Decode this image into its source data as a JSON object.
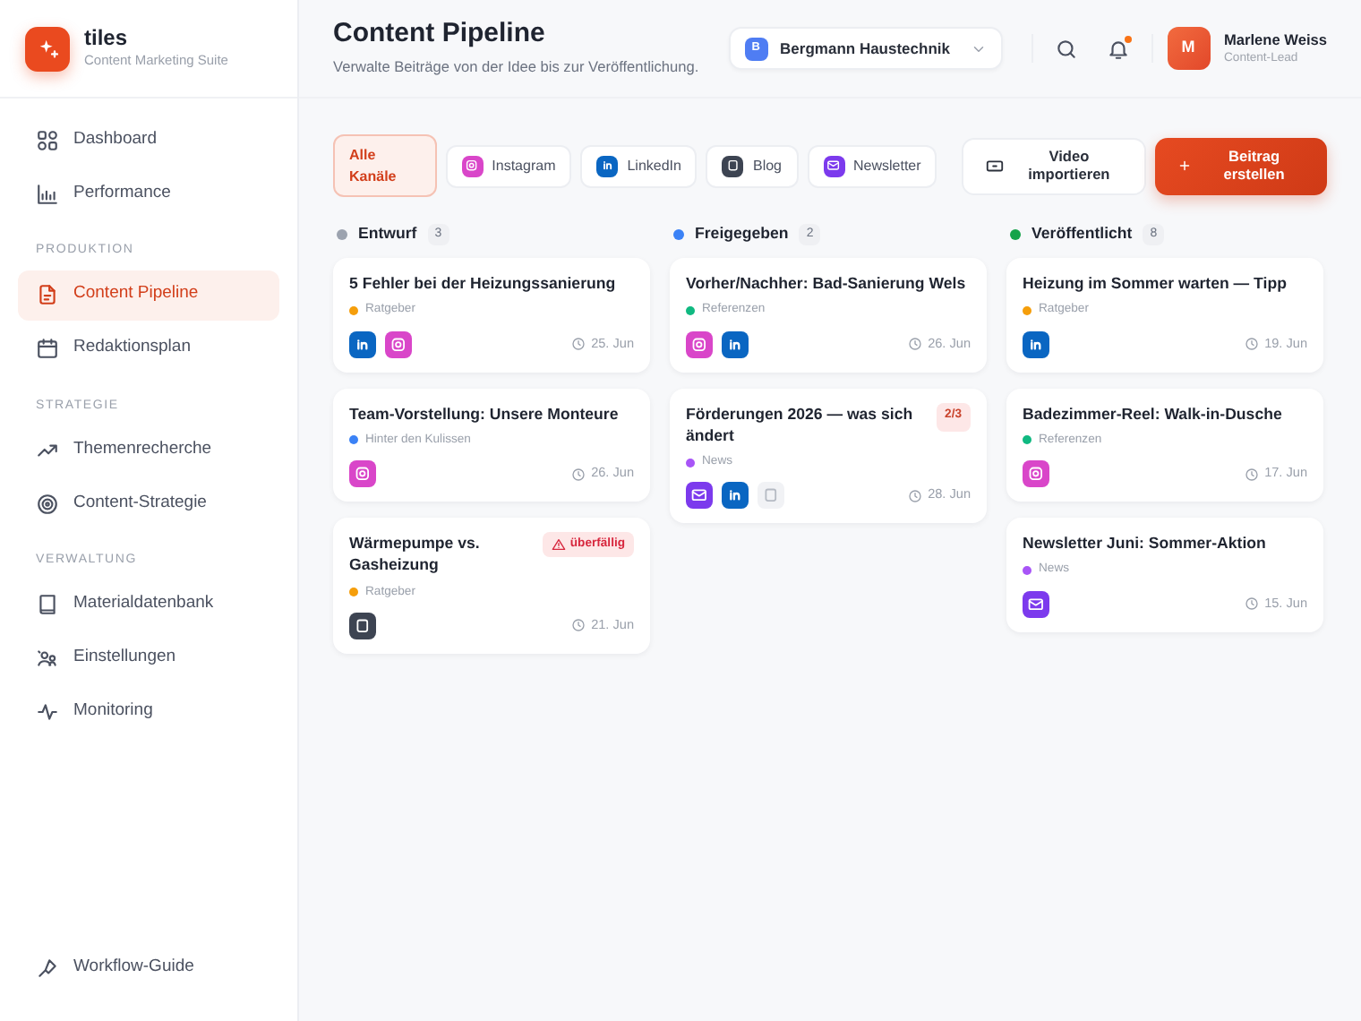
{
  "brand": {
    "name": "tiles",
    "tagline": "Content Marketing Suite"
  },
  "sidebar": {
    "groups": [
      {
        "items": [
          {
            "label": "Dashboard",
            "selected": false
          },
          {
            "label": "Performance",
            "selected": false
          }
        ]
      },
      {
        "heading": "PRODUKTION",
        "items": [
          {
            "label": "Content Pipeline",
            "selected": true
          },
          {
            "label": "Redaktionsplan",
            "selected": false
          }
        ]
      },
      {
        "heading": "STRATEGIE",
        "items": [
          {
            "label": "Themenrecherche",
            "selected": false
          },
          {
            "label": "Content-Strategie",
            "selected": false
          }
        ]
      },
      {
        "heading": "VERWALTUNG",
        "items": [
          {
            "label": "Materialdatenbank",
            "selected": false
          },
          {
            "label": "Einstellungen",
            "selected": false
          },
          {
            "label": "Monitoring",
            "selected": false
          }
        ]
      }
    ],
    "footer_link": "Workflow-Guide"
  },
  "header": {
    "title": "Content Pipeline",
    "subtitle": "Verwalte Beiträge von der Idee bis zur Veröffentlichung.",
    "workspace": {
      "initial": "B",
      "name": "Bergmann Haustechnik"
    },
    "notifications": {
      "unread": true
    },
    "user": {
      "initial": "M",
      "name": "Marlene Weiss",
      "role": "Content-Lead"
    }
  },
  "filters": [
    {
      "label": "Alle Kanäle",
      "kind": "all",
      "selected": true
    },
    {
      "label": "Instagram",
      "kind": "instagram",
      "selected": false
    },
    {
      "label": "LinkedIn",
      "kind": "linkedin",
      "selected": false
    },
    {
      "label": "Blog",
      "kind": "blog",
      "selected": false
    },
    {
      "label": "Newsletter",
      "kind": "newsletter",
      "selected": false
    }
  ],
  "actions": [
    {
      "label": "Video importieren",
      "kind": "secondary"
    },
    {
      "label": "Beitrag erstellen",
      "kind": "primary"
    }
  ],
  "columns": [
    {
      "title": "Entwurf",
      "count": "3",
      "color": "#9ca3af",
      "cards": [
        {
          "title": "5 Fehler bei der Heizungssanierung",
          "tag": {
            "label": "Ratgeber",
            "color": "#f59e0b"
          },
          "channels": [
            {
              "kind": "linkedin",
              "pending": false
            },
            {
              "kind": "instagram",
              "pending": false
            }
          ],
          "date": "25. Jun"
        },
        {
          "title": "Team-Vorstellung: Unsere Monteure",
          "tag": {
            "label": "Hinter den Kulissen",
            "color": "#3b82f6"
          },
          "channels": [
            {
              "kind": "instagram",
              "pending": false
            }
          ],
          "date": "26. Jun"
        },
        {
          "title": "Wärmepumpe vs. Gasheizung",
          "badge": {
            "label": "überfällig",
            "kind": "overdue"
          },
          "tag": {
            "label": "Ratgeber",
            "color": "#f59e0b"
          },
          "channels": [
            {
              "kind": "blog",
              "pending": false
            }
          ],
          "date": "21. Jun"
        }
      ]
    },
    {
      "title": "Freigegeben",
      "count": "2",
      "color": "#3b82f6",
      "cards": [
        {
          "title": "Vorher/Nachher: Bad-Sanierung Wels",
          "tag": {
            "label": "Referenzen",
            "color": "#10b981"
          },
          "channels": [
            {
              "kind": "instagram",
              "pending": false
            },
            {
              "kind": "linkedin",
              "pending": false
            }
          ],
          "date": "26. Jun"
        },
        {
          "title": "Förderungen 2026 — was sich ändert",
          "badge": {
            "label": "2/3",
            "kind": "progress"
          },
          "tag": {
            "label": "News",
            "color": "#a855f7"
          },
          "channels": [
            {
              "kind": "newsletter",
              "pending": false
            },
            {
              "kind": "linkedin",
              "pending": false
            },
            {
              "kind": "blog",
              "pending": true
            }
          ],
          "date": "28. Jun"
        }
      ]
    },
    {
      "title": "Veröffentlicht",
      "count": "8",
      "color": "#16a34a",
      "cards": [
        {
          "title": "Heizung im Sommer warten — Tipp",
          "tag": {
            "label": "Ratgeber",
            "color": "#f59e0b"
          },
          "channels": [
            {
              "kind": "linkedin",
              "pending": false
            }
          ],
          "date": "19. Jun"
        },
        {
          "title": "Badezimmer-Reel: Walk-in-Dusche",
          "tag": {
            "label": "Referenzen",
            "color": "#10b981"
          },
          "channels": [
            {
              "kind": "instagram",
              "pending": false
            }
          ],
          "date": "17. Jun"
        },
        {
          "title": "Newsletter Juni: Sommer-Aktion",
          "tag": {
            "label": "News",
            "color": "#a855f7"
          },
          "channels": [
            {
              "kind": "newsletter",
              "pending": false
            }
          ],
          "date": "15. Jun"
        }
      ]
    }
  ]
}
